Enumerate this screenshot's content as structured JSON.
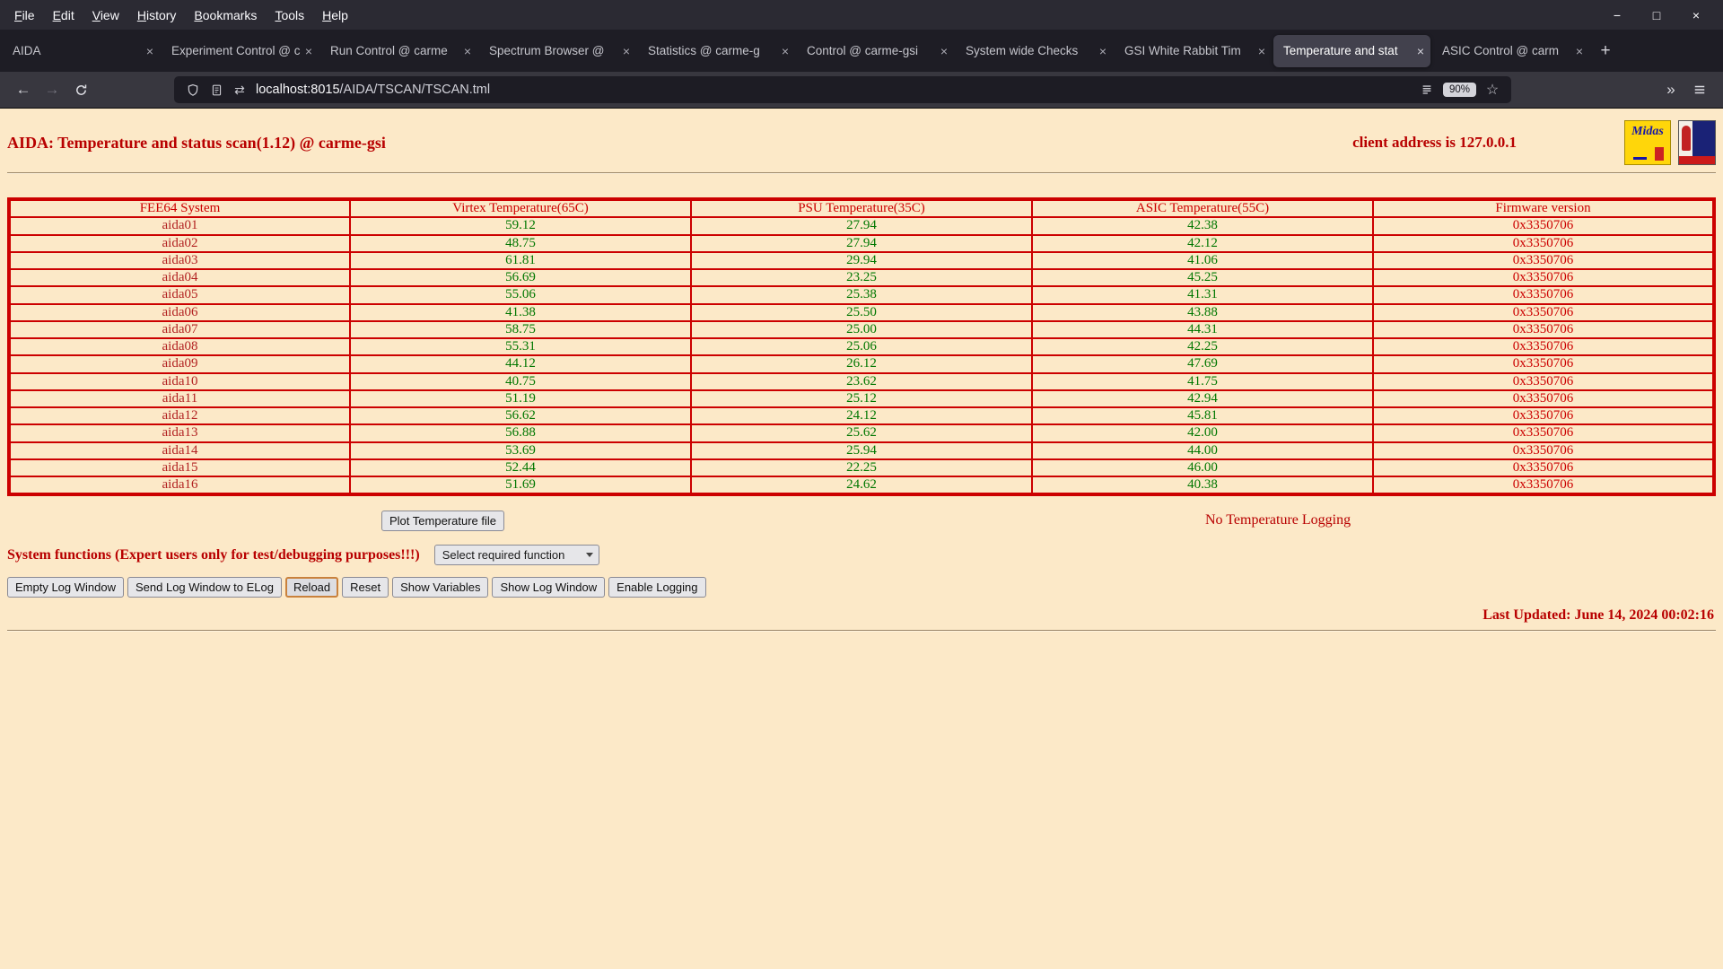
{
  "colors": {
    "page_background": "#fce9c8",
    "text_red": "#b80000",
    "value_green": "#007700",
    "table_border": "#cc0000"
  },
  "icons": {
    "minimize": "−",
    "maximize": "□",
    "window_close": "×",
    "tab_close": "×",
    "new_tab": "+",
    "back": "←",
    "forward": "→",
    "connection": "⇄",
    "star": "☆",
    "overflow": "»"
  },
  "chrome": {
    "menus": [
      "File",
      "Edit",
      "View",
      "History",
      "Bookmarks",
      "Tools",
      "Help"
    ],
    "tabs": [
      {
        "title": "AIDA"
      },
      {
        "title": "Experiment Control @ c"
      },
      {
        "title": "Run Control @ carme"
      },
      {
        "title": "Spectrum Browser @"
      },
      {
        "title": "Statistics @ carme-g"
      },
      {
        "title": "Control @ carme-gsi"
      },
      {
        "title": "System wide Checks"
      },
      {
        "title": "GSI White Rabbit Tim"
      },
      {
        "title": "Temperature and stat",
        "active": true
      },
      {
        "title": "ASIC Control @ carm"
      }
    ],
    "url": {
      "host": "localhost:8015",
      "path": "/AIDA/TSCAN/TSCAN.tml"
    },
    "zoom": "90%"
  },
  "page": {
    "title": "AIDA: Temperature and status scan(1.12) @ carme-gsi",
    "client_address": "client address is 127.0.0.1",
    "logos": {
      "midas": "Midas"
    },
    "table": {
      "headers": [
        "FEE64 System",
        "Virtex Temperature(65C)",
        "PSU Temperature(35C)",
        "ASIC Temperature(55C)",
        "Firmware version"
      ],
      "rows": [
        {
          "system": "aida01",
          "virtex": "59.12",
          "psu": "27.94",
          "asic": "42.38",
          "firmware": "0x3350706"
        },
        {
          "system": "aida02",
          "virtex": "48.75",
          "psu": "27.94",
          "asic": "42.12",
          "firmware": "0x3350706"
        },
        {
          "system": "aida03",
          "virtex": "61.81",
          "psu": "29.94",
          "asic": "41.06",
          "firmware": "0x3350706"
        },
        {
          "system": "aida04",
          "virtex": "56.69",
          "psu": "23.25",
          "asic": "45.25",
          "firmware": "0x3350706"
        },
        {
          "system": "aida05",
          "virtex": "55.06",
          "psu": "25.38",
          "asic": "41.31",
          "firmware": "0x3350706"
        },
        {
          "system": "aida06",
          "virtex": "41.38",
          "psu": "25.50",
          "asic": "43.88",
          "firmware": "0x3350706"
        },
        {
          "system": "aida07",
          "virtex": "58.75",
          "psu": "25.00",
          "asic": "44.31",
          "firmware": "0x3350706"
        },
        {
          "system": "aida08",
          "virtex": "55.31",
          "psu": "25.06",
          "asic": "42.25",
          "firmware": "0x3350706"
        },
        {
          "system": "aida09",
          "virtex": "44.12",
          "psu": "26.12",
          "asic": "47.69",
          "firmware": "0x3350706"
        },
        {
          "system": "aida10",
          "virtex": "40.75",
          "psu": "23.62",
          "asic": "41.75",
          "firmware": "0x3350706"
        },
        {
          "system": "aida11",
          "virtex": "51.19",
          "psu": "25.12",
          "asic": "42.94",
          "firmware": "0x3350706"
        },
        {
          "system": "aida12",
          "virtex": "56.62",
          "psu": "24.12",
          "asic": "45.81",
          "firmware": "0x3350706"
        },
        {
          "system": "aida13",
          "virtex": "56.88",
          "psu": "25.62",
          "asic": "42.00",
          "firmware": "0x3350706"
        },
        {
          "system": "aida14",
          "virtex": "53.69",
          "psu": "25.94",
          "asic": "44.00",
          "firmware": "0x3350706"
        },
        {
          "system": "aida15",
          "virtex": "52.44",
          "psu": "22.25",
          "asic": "46.00",
          "firmware": "0x3350706"
        },
        {
          "system": "aida16",
          "virtex": "51.69",
          "psu": "24.62",
          "asic": "40.38",
          "firmware": "0x3350706"
        }
      ]
    },
    "plot_button_label": "Plot Temperature file",
    "no_logging_text": "No Temperature Logging",
    "system_functions_label": "System functions (Expert users only for test/debugging purposes!!!)",
    "function_select_value": "Select required function",
    "action_buttons": [
      {
        "label": "Empty Log Window"
      },
      {
        "label": "Send Log Window to ELog"
      },
      {
        "label": "Reload",
        "active": true
      },
      {
        "label": "Reset"
      },
      {
        "label": "Show Variables"
      },
      {
        "label": "Show Log Window"
      },
      {
        "label": "Enable Logging"
      }
    ],
    "last_updated": "Last Updated: June 14, 2024 00:02:16"
  }
}
